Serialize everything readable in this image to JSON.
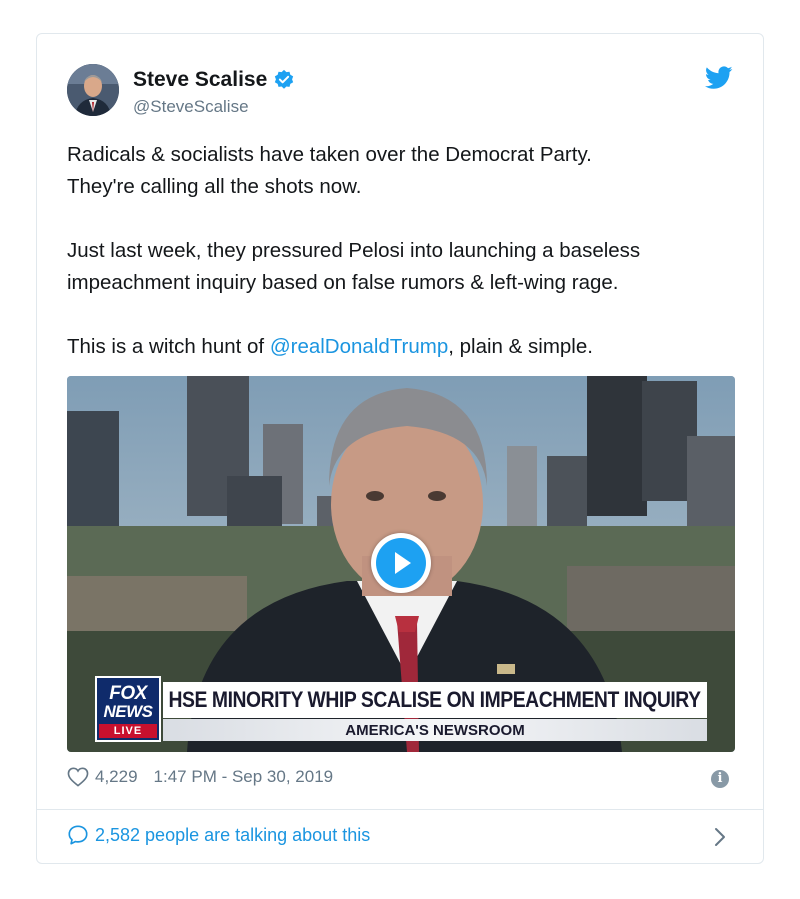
{
  "author": {
    "name": "Steve Scalise",
    "handle": "@SteveScalise",
    "verified": true
  },
  "tweet": {
    "paragraphs": [
      "Radicals & socialists have taken over the Democrat Party.",
      "They're calling all the shots now.",
      "Just last week, they pressured Pelosi into launching a baseless",
      "impeachment inquiry based on false rumors & left-wing rage."
    ],
    "last_line_prefix": "This is a witch hunt of ",
    "mention": "@realDonaldTrump",
    "last_line_suffix": ", plain & simple."
  },
  "video": {
    "network_logo_line1": "FOX",
    "network_logo_line2": "NEWS",
    "network_logo_line3": "LIVE",
    "headline": "HSE MINORITY WHIP SCALISE ON IMPEACHMENT INQUIRY",
    "program": "AMERICA'S NEWSROOM"
  },
  "meta": {
    "likes": "4,229",
    "timestamp": "1:47 PM - Sep 30, 2019"
  },
  "footer": {
    "talking": "2,582 people are talking about this"
  },
  "colors": {
    "link": "#1b95e0",
    "brand": "#1da1f2",
    "muted": "#657786",
    "border": "#e1e8ed"
  },
  "icons": [
    "verified-badge-icon",
    "twitter-bird-icon",
    "play-icon",
    "heart-icon",
    "info-icon",
    "speech-bubble-icon",
    "chevron-right-icon"
  ]
}
